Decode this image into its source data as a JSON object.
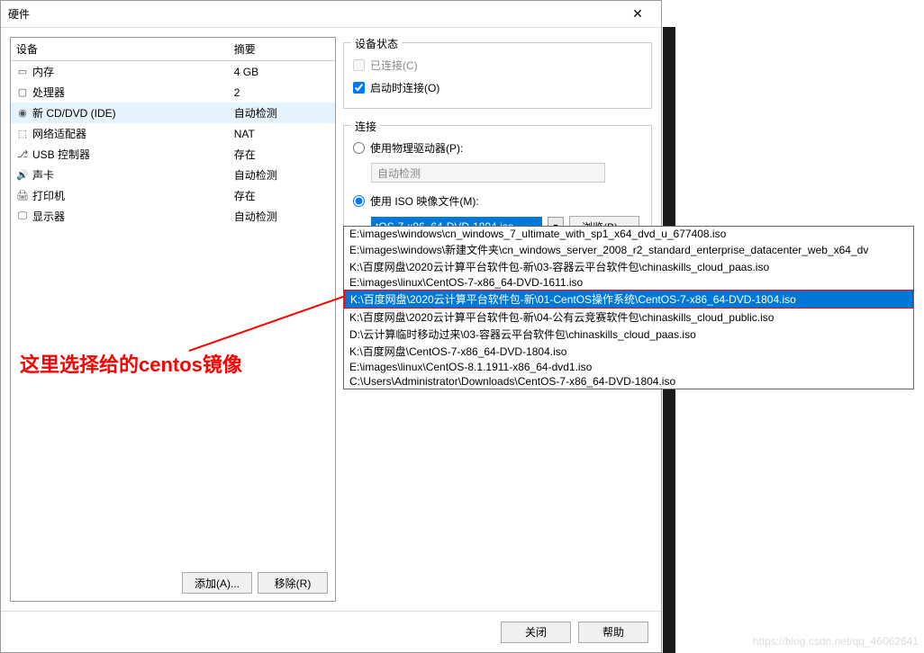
{
  "dialog": {
    "title": "硬件",
    "close_icon": "✕"
  },
  "device_table": {
    "header_device": "设备",
    "header_summary": "摘要",
    "rows": [
      {
        "icon": "▭",
        "name": "内存",
        "summary": "4 GB"
      },
      {
        "icon": "▢",
        "name": "处理器",
        "summary": "2"
      },
      {
        "icon": "◉",
        "name": "新 CD/DVD (IDE)",
        "summary": "自动检测",
        "selected": true
      },
      {
        "icon": "⬚",
        "name": "网络适配器",
        "summary": "NAT"
      },
      {
        "icon": "⎇",
        "name": "USB 控制器",
        "summary": "存在"
      },
      {
        "icon": "🔊",
        "name": "声卡",
        "summary": "自动检测"
      },
      {
        "icon": "🖨",
        "name": "打印机",
        "summary": "存在"
      },
      {
        "icon": "🖵",
        "name": "显示器",
        "summary": "自动检测"
      }
    ]
  },
  "left_buttons": {
    "add": "添加(A)...",
    "remove": "移除(R)"
  },
  "device_state": {
    "title": "设备状态",
    "connected": "已连接(C)",
    "connect_on_start": "启动时连接(O)"
  },
  "connection": {
    "title": "连接",
    "use_physical": "使用物理驱动器(P):",
    "auto_detect": "自动检测",
    "use_iso": "使用 ISO 映像文件(M):",
    "iso_value": "tOS-7-x86_64-DVD-1804.iso",
    "browse": "浏览(B)..."
  },
  "dropdown": {
    "items": [
      "E:\\images\\windows\\cn_windows_7_ultimate_with_sp1_x64_dvd_u_677408.iso",
      "E:\\images\\windows\\新建文件夹\\cn_windows_server_2008_r2_standard_enterprise_datacenter_web_x64_dv",
      "K:\\百度网盘\\2020云计算平台软件包-新\\03-容器云平台软件包\\chinaskills_cloud_paas.iso",
      "E:\\images\\linux\\CentOS-7-x86_64-DVD-1611.iso",
      "K:\\百度网盘\\2020云计算平台软件包-新\\01-CentOS操作系统\\CentOS-7-x86_64-DVD-1804.iso",
      "K:\\百度网盘\\2020云计算平台软件包-新\\04-公有云竞赛软件包\\chinaskills_cloud_public.iso",
      "D:\\云计算临时移动过来\\03-容器云平台软件包\\chinaskills_cloud_paas.iso",
      "K:\\百度网盘\\CentOS-7-x86_64-DVD-1804.iso",
      "E:\\images\\linux\\CentOS-8.1.1911-x86_64-dvd1.iso",
      "C:\\Users\\Administrator\\Downloads\\CentOS-7-x86_64-DVD-1804.iso"
    ],
    "highlighted_index": 4
  },
  "annotation": {
    "text": "这里选择给的centos镜像"
  },
  "footer": {
    "close": "关闭",
    "help": "帮助"
  },
  "watermark": "https://blog.csdn.net/qq_46062641"
}
